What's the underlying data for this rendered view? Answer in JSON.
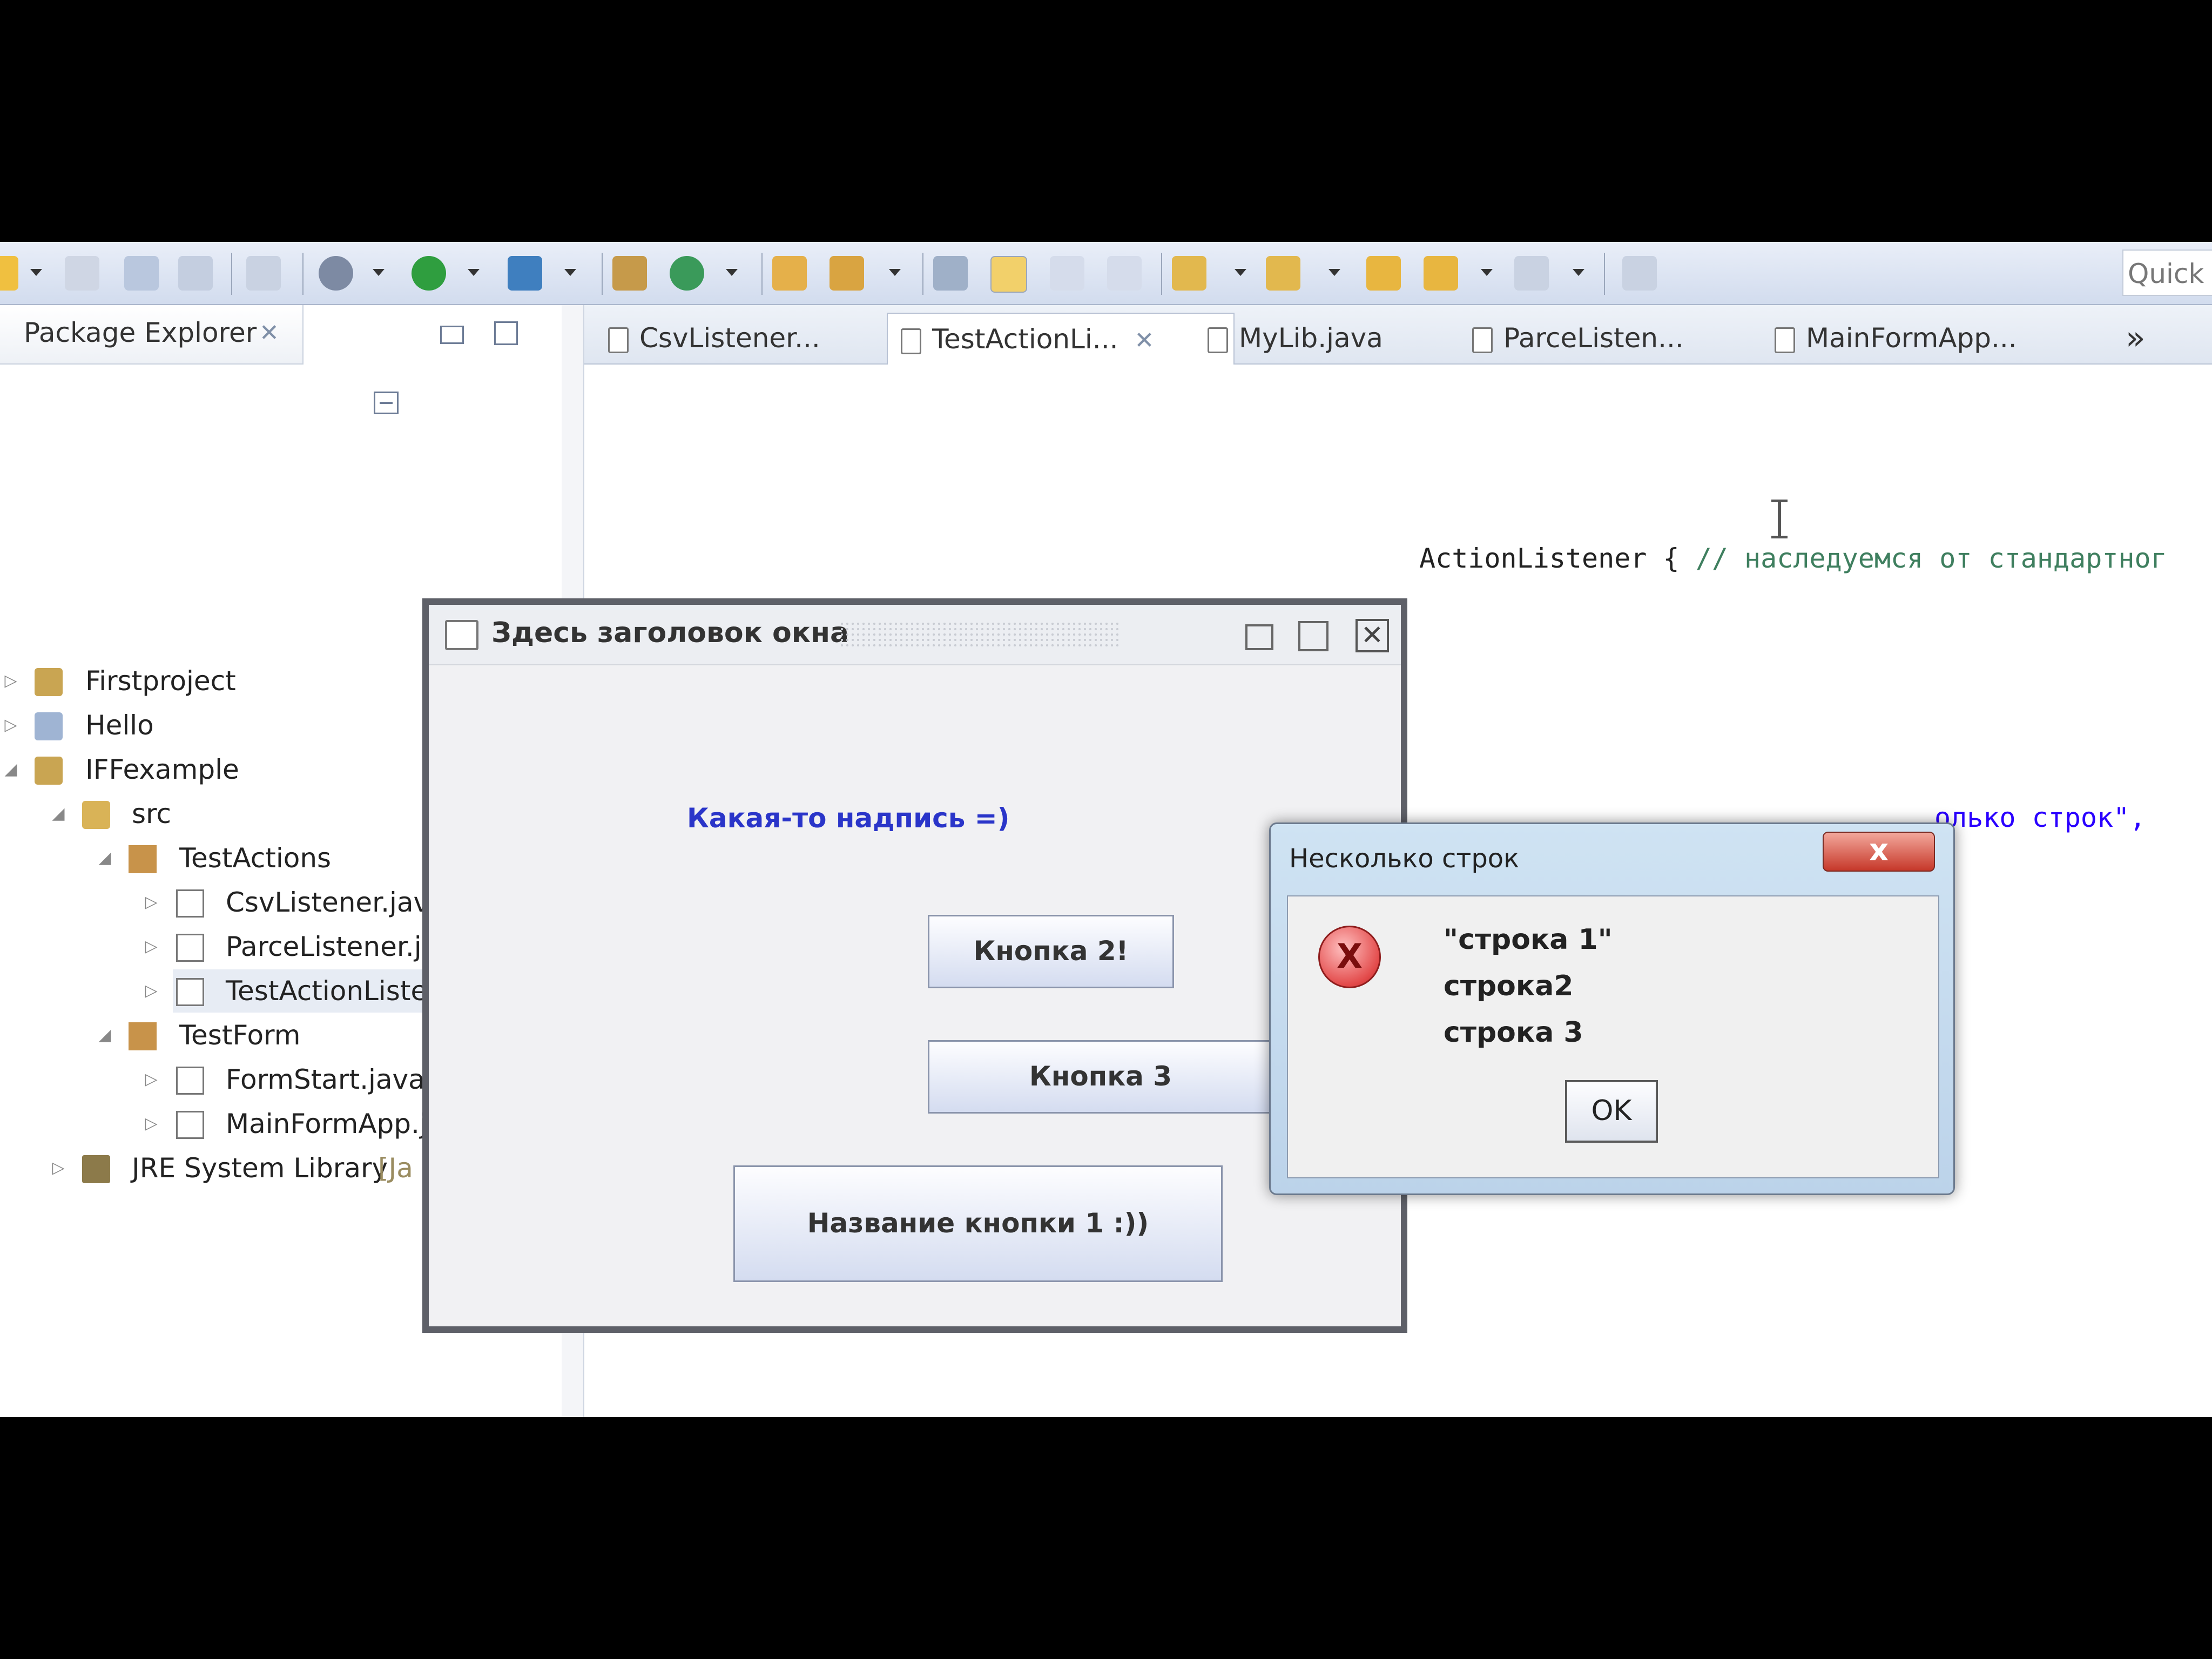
{
  "toolbar": {
    "quick_access": "Quick"
  },
  "package_explorer": {
    "title": "Package Explorer",
    "tree": [
      {
        "label": "Firstproject"
      },
      {
        "label": "Hello"
      },
      {
        "label": "IFFexample"
      },
      {
        "label": "src"
      },
      {
        "label": "TestActions"
      },
      {
        "label": "CsvListener.java"
      },
      {
        "label": "ParceListener.java"
      },
      {
        "label": "TestActionListener.java"
      },
      {
        "label": "TestForm"
      },
      {
        "label": "FormStart.java"
      },
      {
        "label": "MainFormApp.java"
      },
      {
        "label": "JRE System Library",
        "suffix": "[Ja"
      }
    ]
  },
  "editor": {
    "tabs": [
      {
        "label": "CsvListener..."
      },
      {
        "label": "TestActionLi..."
      },
      {
        "label": "MyLib.java"
      },
      {
        "label": "ParceListen..."
      },
      {
        "label": "MainFormApp..."
      }
    ],
    "overflow_tabs": "»",
    "code_line_1_code": "ActionListener {",
    "code_line_1_comment": "// наследуемся от стандартног",
    "code_line_2": "олько строк\","
  },
  "frame": {
    "title": "Здесь заголовок окна",
    "label": "Какая-то надпись =)",
    "button2": "Кнопка 2!",
    "button3": "Кнопка 3",
    "button1": "Название кнопки 1 :))"
  },
  "dialog": {
    "title": "Несколько строк",
    "close": "x",
    "icon": "X",
    "lines": [
      "\"строка 1\"",
      "строка2",
      "строка 3"
    ],
    "ok": "OK"
  }
}
